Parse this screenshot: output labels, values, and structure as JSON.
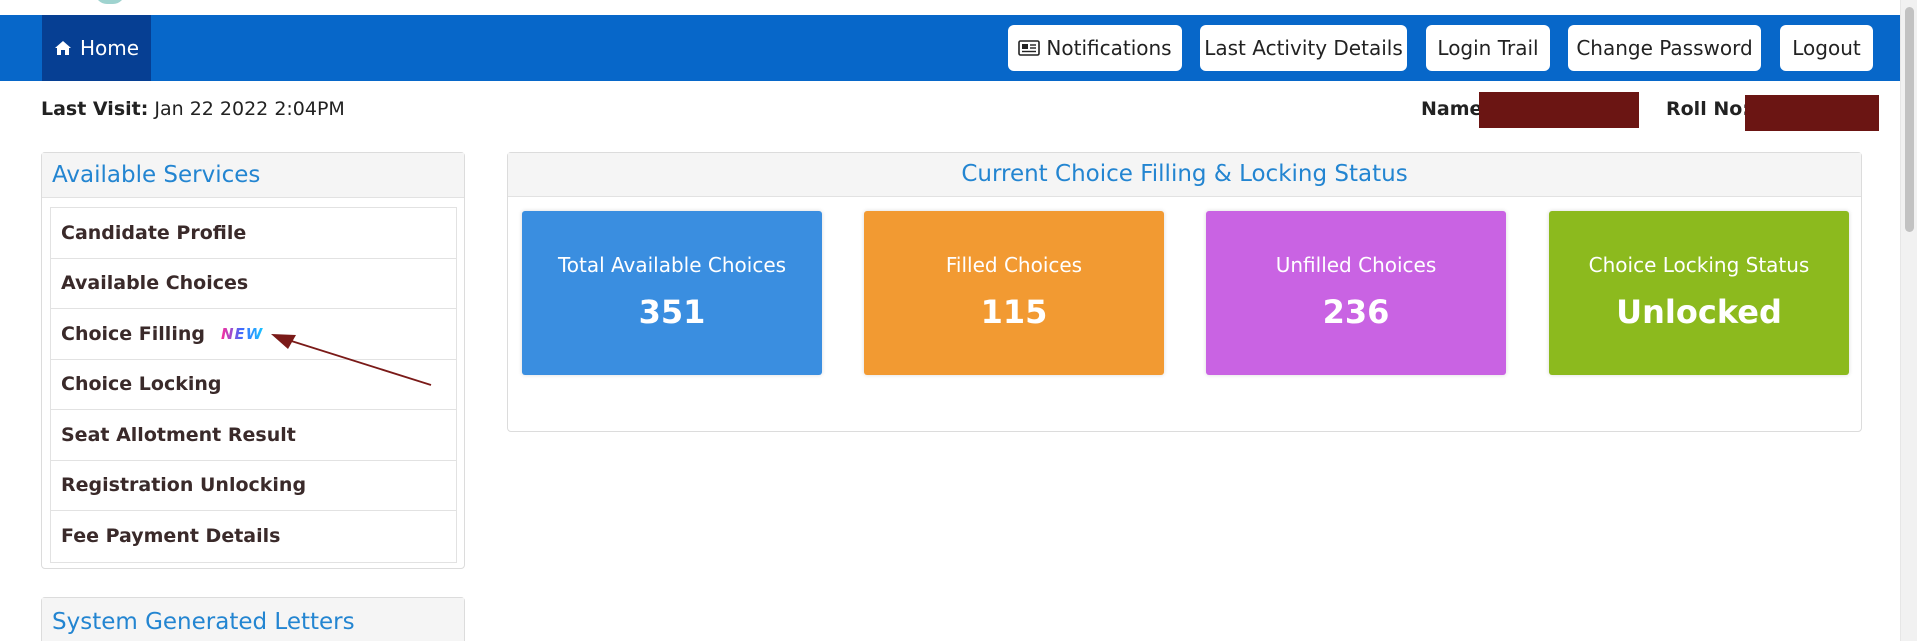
{
  "navbar": {
    "home_label": "Home",
    "buttons": [
      {
        "label": "Notifications"
      },
      {
        "label": "Last Activity Details"
      },
      {
        "label": "Login Trail"
      },
      {
        "label": "Change Password"
      },
      {
        "label": "Logout"
      }
    ]
  },
  "header": {
    "last_visit_label": "Last Visit:",
    "last_visit_value": "Jan 22 2022 2:04PM",
    "name_label": "Name",
    "roll_label": "Roll No:"
  },
  "services": {
    "title": "Available Services",
    "items": [
      {
        "label": "Candidate Profile"
      },
      {
        "label": "Available Choices"
      },
      {
        "label": "Choice Filling",
        "badge": "NEW"
      },
      {
        "label": "Choice Locking"
      },
      {
        "label": "Seat Allotment Result"
      },
      {
        "label": "Registration Unlocking"
      },
      {
        "label": "Fee Payment Details"
      }
    ]
  },
  "letters": {
    "title": "System Generated Letters"
  },
  "status": {
    "title": "Current Choice Filling & Locking Status",
    "cards": [
      {
        "title": "Total Available Choices",
        "value": "351",
        "color": "#3a8ee0"
      },
      {
        "title": "Filled Choices",
        "value": "115",
        "color": "#f29a32"
      },
      {
        "title": "Unfilled Choices",
        "value": "236",
        "color": "#c963e3"
      },
      {
        "title": "Choice Locking Status",
        "value": "Unlocked",
        "color": "#8cba1e"
      }
    ]
  },
  "colors": {
    "navbar": "#0767c9",
    "home_active": "#063f93",
    "accent_text": "#2385d1",
    "redaction": "#6b1513",
    "annotation_arrow": "#7a1a18"
  },
  "icons": [
    "home-icon",
    "newspaper-icon"
  ]
}
